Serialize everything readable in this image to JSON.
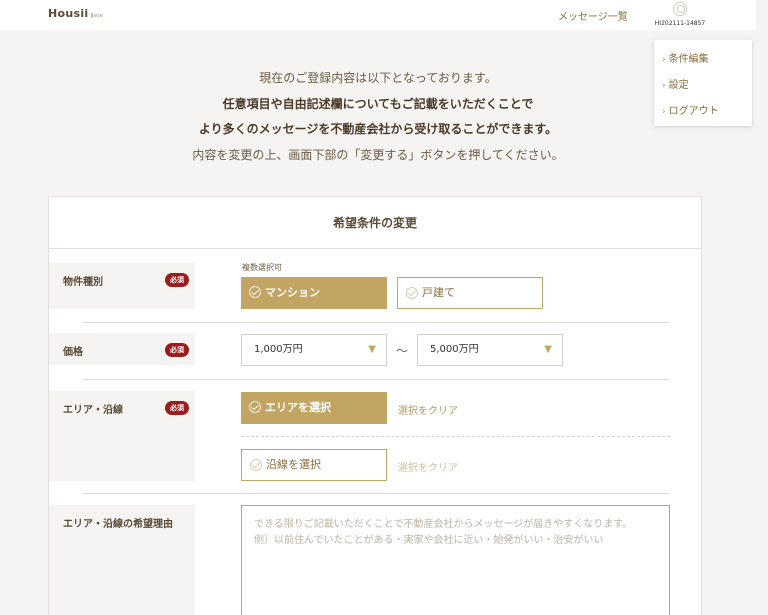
{
  "header": {
    "logo": "Housii",
    "logo_sub": "βeta",
    "messages_link": "メッセージ一覧",
    "user_id": "HI202111-14857"
  },
  "dropdown": {
    "items": [
      {
        "label": "条件編集"
      },
      {
        "label": "設定"
      },
      {
        "label": "ログアウト"
      }
    ]
  },
  "intro": {
    "line1": "現在のご登録内容は以下となっております。",
    "line2": "任意項目や自由記述欄についてもご記載をいただくことで",
    "line3": "より多くのメッセージを不動産会社から受け取ることができます。",
    "line4": "内容を変更の上、画面下部の「変更する」ボタンを押してください。"
  },
  "form": {
    "title": "希望条件の変更",
    "required_badge": "必須",
    "property_type": {
      "label": "物件種別",
      "hint": "複数選択可",
      "options": [
        {
          "label": "マンション",
          "selected": true
        },
        {
          "label": "戸建て",
          "selected": false
        }
      ]
    },
    "price": {
      "label": "価格",
      "min": "1,000万円",
      "max": "5,000万円",
      "separator": "〜"
    },
    "area": {
      "label": "エリア・沿線",
      "area_button": "エリアを選択",
      "area_clear": "選択をクリア",
      "line_button": "沿線を選択",
      "line_clear": "選択をクリア"
    },
    "reason": {
      "label": "エリア・沿線の希望理由",
      "placeholder_line1": "できる限りご記載いただくことで不動産会社からメッセージが届きやすくなります。",
      "placeholder_line2": "例）以前住んでいたことがある・実家や会社に近い・始発がいい・治安がいい"
    }
  }
}
